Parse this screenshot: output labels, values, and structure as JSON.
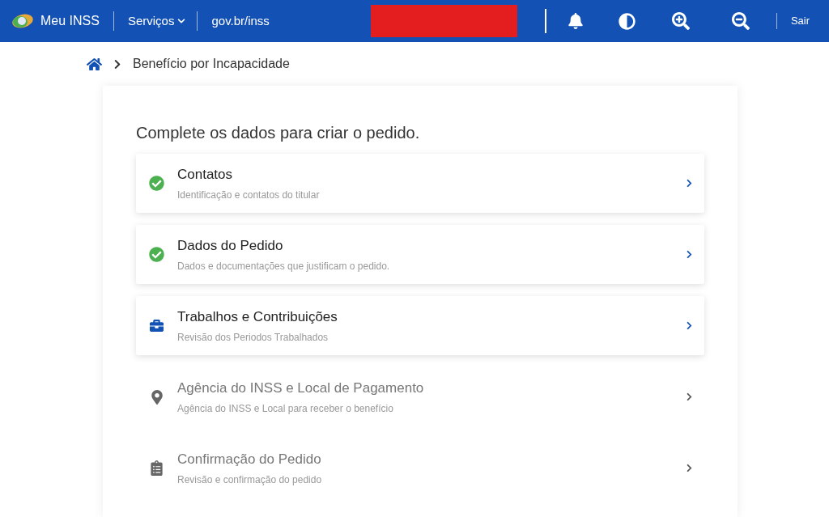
{
  "header": {
    "brand": "Meu INSS",
    "menu": "Serviços",
    "link": "gov.br/inss",
    "logout": "Sair"
  },
  "breadcrumb": {
    "current": "Benefício por Incapacidade"
  },
  "heading": "Complete os dados para criar o pedido.",
  "steps": [
    {
      "kind": "done",
      "title": "Contatos",
      "subtitle": "Identificação e contatos do titular",
      "disabled": false
    },
    {
      "kind": "done",
      "title": "Dados do Pedido",
      "subtitle": "Dados e documentações que justificam o pedido.",
      "disabled": false
    },
    {
      "kind": "work",
      "title": "Trabalhos e Contribuições",
      "subtitle": "Revisão dos Periodos Trabalhados",
      "disabled": false
    },
    {
      "kind": "place",
      "title": "Agência do INSS e Local de Pagamento",
      "subtitle": "Agência do INSS e Local para receber o benefício",
      "disabled": true
    },
    {
      "kind": "review",
      "title": "Confirmação do Pedido",
      "subtitle": "Revisão e confirmação do pedido",
      "disabled": true
    }
  ]
}
